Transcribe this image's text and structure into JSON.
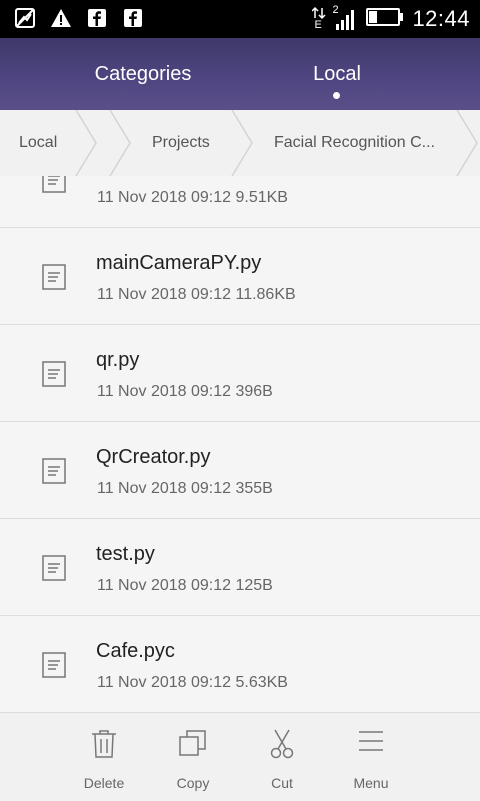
{
  "status_bar": {
    "time": "12:44",
    "network_label": "E",
    "sim_number": "2",
    "icons": [
      "gallery-icon",
      "warning-icon",
      "facebook-icon",
      "facebook-icon"
    ]
  },
  "tabs": [
    {
      "label": "Categories",
      "active": false
    },
    {
      "label": "Local",
      "active": true
    }
  ],
  "breadcrumb": [
    "Local",
    "Projects",
    "Facial Recognition C..."
  ],
  "files": [
    {
      "name": "",
      "meta": "11 Nov 2018 09:12 9.51KB"
    },
    {
      "name": "mainCameraPY.py",
      "meta": "11 Nov 2018 09:12 11.86KB"
    },
    {
      "name": "qr.py",
      "meta": "11 Nov 2018 09:12 396B"
    },
    {
      "name": "QrCreator.py",
      "meta": "11 Nov 2018 09:12 355B"
    },
    {
      "name": "test.py",
      "meta": "11 Nov 2018 09:12 125B"
    },
    {
      "name": "Cafe.pyc",
      "meta": "11 Nov 2018 09:12 5.63KB"
    }
  ],
  "toolbar": [
    {
      "label": "Delete",
      "icon": "trash-icon"
    },
    {
      "label": "Copy",
      "icon": "copy-icon"
    },
    {
      "label": "Cut",
      "icon": "scissors-icon"
    },
    {
      "label": "Menu",
      "icon": "menu-icon"
    }
  ],
  "colors": {
    "header_top": "#3e3968",
    "header_bottom": "#5b4f89",
    "background": "#f5f5f5"
  }
}
